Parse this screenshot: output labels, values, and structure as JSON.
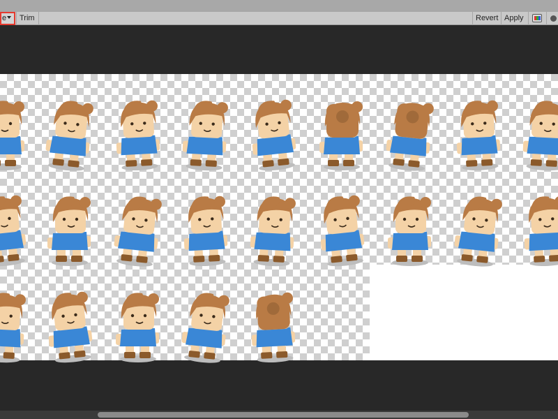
{
  "toolbar": {
    "mode_label": "e",
    "trim_label": "Trim",
    "revert_label": "Revert",
    "apply_label": "Apply",
    "color_icon": "rgb-channels-icon",
    "alpha_icon": "alpha-dot-icon"
  },
  "colors": {
    "toolbar_bg": "#c9c9c9",
    "canvas_bg": "#282828",
    "highlight": "#e53a2f",
    "hair": "#b97b45",
    "skin": "#f4d2a6",
    "shirt": "#3a87d6",
    "boots": "#8b5a2b"
  },
  "sprite_sheet": {
    "rows": [
      9,
      9,
      5
    ],
    "cell_count": 23
  }
}
